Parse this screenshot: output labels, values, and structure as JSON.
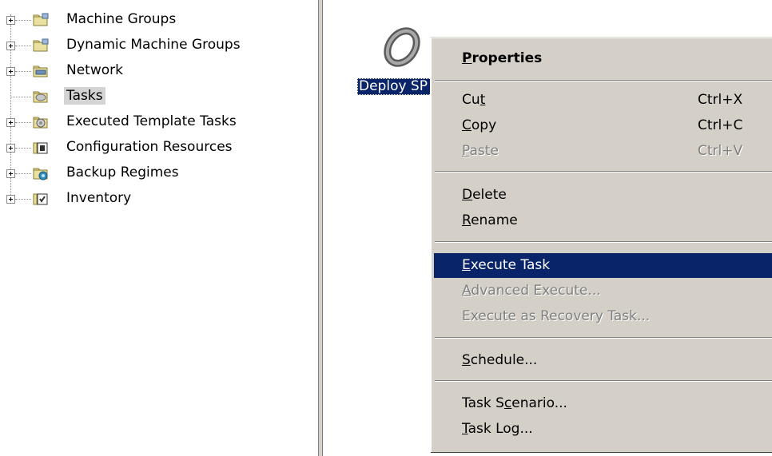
{
  "tree": {
    "items": [
      {
        "label": "Machine Groups",
        "icon": "folder-icon",
        "expandable": true,
        "selected": false
      },
      {
        "label": "Dynamic Machine Groups",
        "icon": "folder-icon",
        "expandable": true,
        "selected": false
      },
      {
        "label": "Network",
        "icon": "network-folder-icon",
        "expandable": true,
        "selected": false
      },
      {
        "label": "Tasks",
        "icon": "tasks-folder-icon",
        "expandable": false,
        "selected": true
      },
      {
        "label": "Executed Template Tasks",
        "icon": "executed-tasks-folder-icon",
        "expandable": true,
        "selected": false
      },
      {
        "label": "Configuration Resources",
        "icon": "configuration-resources-icon",
        "expandable": true,
        "selected": false
      },
      {
        "label": "Backup Regimes",
        "icon": "backup-folder-icon",
        "expandable": true,
        "selected": false
      },
      {
        "label": "Inventory",
        "icon": "inventory-icon",
        "expandable": true,
        "selected": false
      }
    ]
  },
  "right_pane": {
    "task_item_label": "Deploy SP"
  },
  "context_menu": {
    "items": {
      "properties": {
        "pre": "",
        "key": "P",
        "post": "roperties",
        "accel": ""
      },
      "cut": {
        "pre": "Cu",
        "key": "t",
        "post": "",
        "accel": "Ctrl+X"
      },
      "copy": {
        "pre": "",
        "key": "C",
        "post": "opy",
        "accel": "Ctrl+C"
      },
      "paste": {
        "pre": "",
        "key": "P",
        "post": "aste",
        "accel": "Ctrl+V"
      },
      "delete": {
        "pre": "",
        "key": "D",
        "post": "elete",
        "accel": ""
      },
      "rename": {
        "pre": "",
        "key": "R",
        "post": "ename",
        "accel": ""
      },
      "execute_task": {
        "pre": "",
        "key": "E",
        "post": "xecute Task",
        "accel": ""
      },
      "advanced_execute": {
        "pre": "",
        "key": "A",
        "post": "dvanced Execute...",
        "accel": ""
      },
      "execute_recovery": {
        "pre": "Execute as Recovery Task...",
        "key": "",
        "post": "",
        "accel": ""
      },
      "schedule": {
        "pre": "",
        "key": "S",
        "post": "chedule...",
        "accel": ""
      },
      "task_scenario": {
        "pre": "Task S",
        "key": "c",
        "post": "enario...",
        "accel": ""
      },
      "task_log": {
        "pre": "",
        "key": "T",
        "post": "ask Log...",
        "accel": ""
      }
    }
  },
  "colors": {
    "selection_highlight": "#0a246a",
    "menu_background": "#d4d0c8",
    "disabled_text": "#808080"
  }
}
